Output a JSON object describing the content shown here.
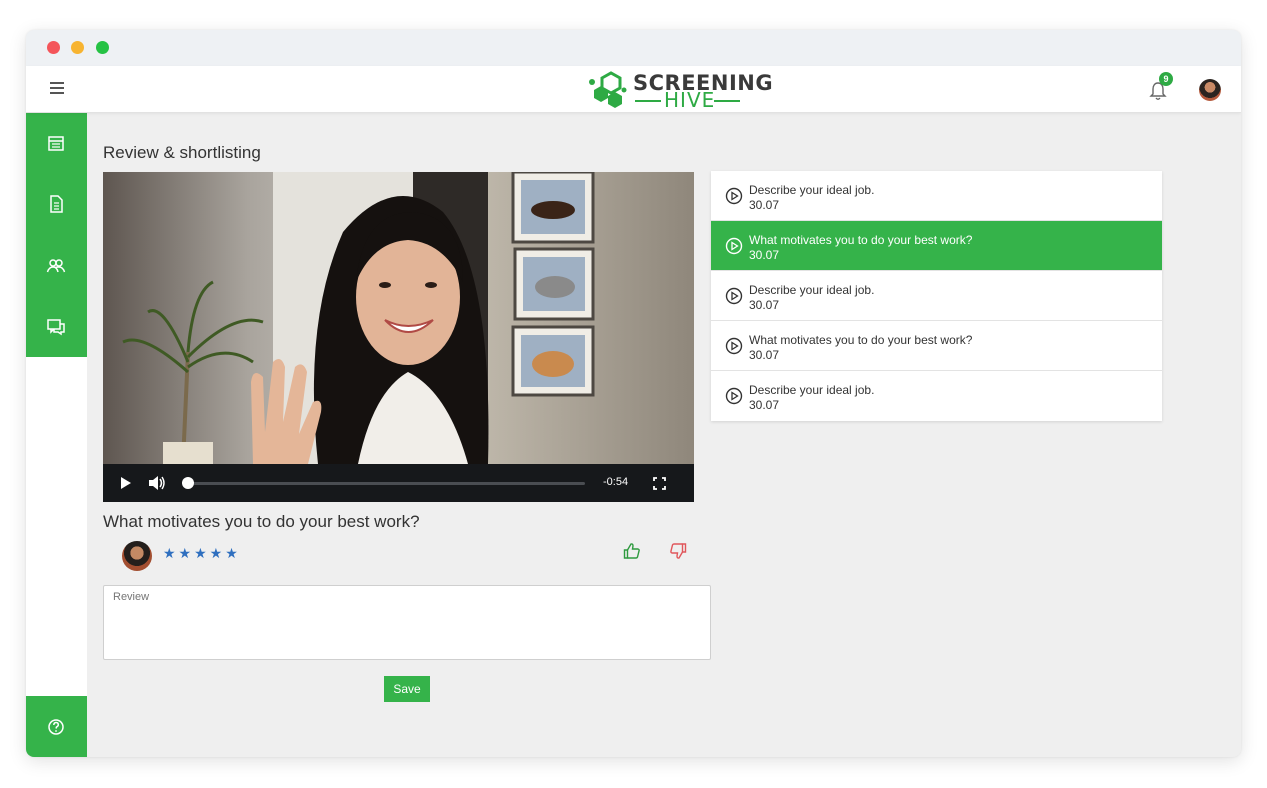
{
  "app": {
    "logo_line1": "SCREENING",
    "logo_line2": "HIVE",
    "notification_count": "9"
  },
  "page": {
    "title": "Review & shortlisting"
  },
  "sidebar": {
    "items": [
      {
        "icon": "calendar-icon"
      },
      {
        "icon": "document-icon"
      },
      {
        "icon": "users-icon"
      },
      {
        "icon": "chat-icon"
      }
    ],
    "help_icon": "help-icon"
  },
  "video": {
    "time_remaining": "-0:54",
    "progress": 0
  },
  "current_question": {
    "title": "What motivates you to do your best work?",
    "rating": 5,
    "stars": "★★★★★"
  },
  "review": {
    "placeholder": "Review",
    "save_label": "Save"
  },
  "questions": [
    {
      "text": "Describe your ideal job.",
      "duration": "30.07",
      "active": false
    },
    {
      "text": "What motivates you to do your best work?",
      "duration": "30.07",
      "active": true
    },
    {
      "text": "Describe your ideal job.",
      "duration": "30.07",
      "active": false
    },
    {
      "text": "What motivates you to do your best work?",
      "duration": "30.07",
      "active": false
    },
    {
      "text": "Describe your ideal job.",
      "duration": "30.07",
      "active": false
    }
  ],
  "colors": {
    "brand_green": "#35b34a",
    "dislike_red": "#e0565b",
    "star_blue": "#2f6fbf"
  }
}
